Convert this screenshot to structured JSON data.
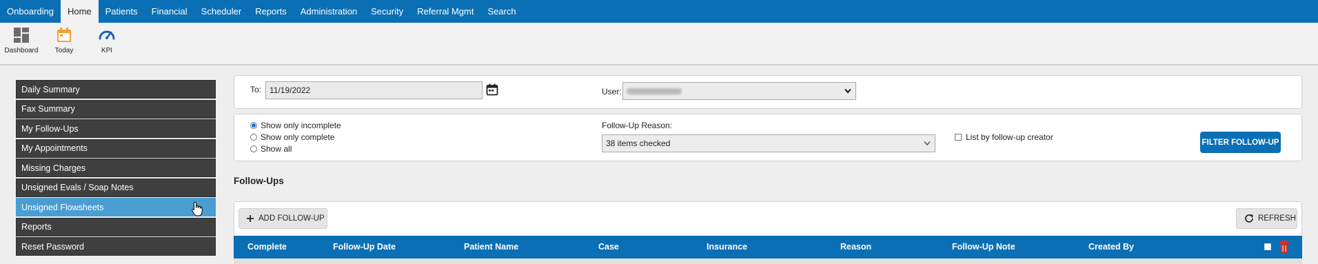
{
  "nav": {
    "items": [
      "Onboarding",
      "Home",
      "Patients",
      "Financial",
      "Scheduler",
      "Reports",
      "Administration",
      "Security",
      "Referral Mgmt",
      "Search"
    ],
    "active": "Home"
  },
  "toolbar": {
    "dashboard_label": "Dashboard",
    "today_label": "Today",
    "kpi_label": "KPI"
  },
  "sidebar": {
    "items": [
      {
        "label": "Daily Summary"
      },
      {
        "label": "Fax Summary"
      },
      {
        "label": "My Follow-Ups"
      },
      {
        "label": "My Appointments"
      },
      {
        "label": "Missing Charges"
      },
      {
        "label": "Unsigned Evals / Soap Notes"
      },
      {
        "label": "Unsigned Flowsheets"
      },
      {
        "label": "Reports"
      },
      {
        "label": "Reset Password"
      }
    ],
    "active_index": 6
  },
  "filters": {
    "to_label": "To:",
    "to_value": "11/19/2022",
    "user_label": "User:",
    "radio_options": [
      "Show only incomplete",
      "Show only complete",
      "Show all"
    ],
    "radio_selected": 0,
    "reason_label": "Follow-Up Reason:",
    "reason_value": "38 items checked",
    "creator_checkbox_label": "List by follow-up creator",
    "filter_button": "FILTER FOLLOW-UP"
  },
  "followups": {
    "title": "Follow-Ups",
    "add_button": "ADD FOLLOW-UP",
    "refresh_button": "REFRESH",
    "columns": [
      "Complete",
      "Follow-Up Date",
      "Patient Name",
      "Case",
      "Insurance",
      "Reason",
      "Follow-Up Note",
      "Created By"
    ]
  },
  "colors": {
    "brand_blue": "#0a6fb4",
    "sidebar_dark": "#3f3f3f",
    "sidebar_active": "#4a9dd1",
    "today_orange": "#f0a030",
    "trash_red": "#d9302c"
  }
}
